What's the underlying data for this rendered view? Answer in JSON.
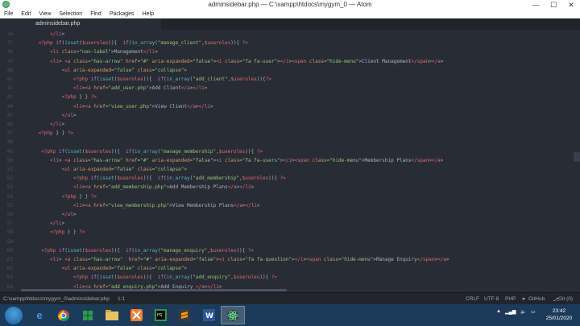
{
  "window": {
    "title": "adminsidebar.php — C:\\xampp\\htdocs\\mygym_0 — Atom",
    "minimize": "—",
    "maximize": "☐",
    "close": "✕"
  },
  "menu": [
    "File",
    "Edit",
    "View",
    "Selection",
    "Find",
    "Packages",
    "Help"
  ],
  "tab": {
    "label": "adminsidebar.php"
  },
  "editor": {
    "lines": [
      {
        "n": "36",
        "code": "          </li>"
      },
      {
        "n": "37",
        "code": "      <?php if(isset($useroles)){  if(in_array(\"manage_client\",$useroles)){ ?>"
      },
      {
        "n": "38",
        "code": "          <li class=\"nav-label\">Management</li>"
      },
      {
        "n": "39",
        "code": "          <li> <a class=\"has-arrow\" href=\"#\" aria-expanded=\"false\"><i class=\"fa fa-user\"></i><span class=\"hide-menu\">Client Management</span></a>"
      },
      {
        "n": "40",
        "code": "              <ul aria-expanded=\"false\" class=\"collapse\">"
      },
      {
        "n": "41",
        "code": "                  <?php if(isset($useroles)){  if(in_array(\"add_client\",$useroles)){?>"
      },
      {
        "n": "42",
        "code": "                  <li><a href=\"add_user.php\">Add Client</a></li>"
      },
      {
        "n": "43",
        "code": "              <?php } } ?>"
      },
      {
        "n": "44",
        "code": "                  <li><a href=\"view_user.php\">View Client</a></li>"
      },
      {
        "n": "45",
        "code": "              </ul>"
      },
      {
        "n": "46",
        "code": "          </li>"
      },
      {
        "n": "47",
        "code": "      <?php } } ?>"
      },
      {
        "n": "48",
        "code": ""
      },
      {
        "n": "49",
        "code": "       <?php if(isset($useroles)){  if(in_array(\"manage_membership\",$useroles)){ ?>"
      },
      {
        "n": "50",
        "code": "          <li> <a class=\"has-arrow\" href=\"#\" aria-expanded=\"false\"><i class=\"fa fa-users\"></i><span class=\"hide-menu\">Membership Plans</span></a>"
      },
      {
        "n": "51",
        "code": "              <ul aria-expanded=\"false\" class=\"collapse\">"
      },
      {
        "n": "52",
        "code": "                  <?php if(isset($useroles)){  if(in_array(\"add_membership\",$useroles)){ ?>"
      },
      {
        "n": "53",
        "code": "                  <li><a href=\"add_membership.php\">Add Membership Plans</a></li>"
      },
      {
        "n": "54",
        "code": "              <?php } } ?>"
      },
      {
        "n": "55",
        "code": "                  <li><a href=\"view_membership.php\">View Membership Plans</a></li>"
      },
      {
        "n": "56",
        "code": "              </ul>"
      },
      {
        "n": "57",
        "code": "          </li>"
      },
      {
        "n": "58",
        "code": "          <?php } } ?>"
      },
      {
        "n": "59",
        "code": ""
      },
      {
        "n": "60",
        "code": "       <?php if(isset($useroles)){  if(in_array(\"manage_enquiry\",$useroles)){ ?>"
      },
      {
        "n": "61",
        "code": "          <li> <a class=\"has-arrow\"  href=\"#\" aria-expanded=\"false\"><i class=\"fa fa-question\"></i><span class=\"hide-menu\">Manage Enquiry</span></a>"
      },
      {
        "n": "62",
        "code": "              <ul aria-expanded=\"false\" class=\"collapse\">"
      },
      {
        "n": "63",
        "code": "                  <?php if(isset($useroles)){  if(in_array(\"add_enquiry\",$useroles)){ ?>"
      },
      {
        "n": "64",
        "code": "                  <li><a href=\"add_enquiry.php\">Add Enquiry </a></li>"
      }
    ]
  },
  "status": {
    "path": "C:\\xampp\\htdocs\\mygym_0\\adminsidebar.php",
    "cursor": "1:1",
    "line_ending": "CRLF",
    "encoding": "UTF-8",
    "grammar": "PHP",
    "github": "GitHub",
    "git": "Git (0)"
  },
  "taskbar": {
    "icons": [
      "windows-start-icon",
      "ie-icon",
      "chrome-icon",
      "store-icon",
      "explorer-icon",
      "xampp-icon",
      "phpstorm-icon",
      "sublime-icon",
      "word-icon",
      "atom-icon"
    ],
    "time": "23:42",
    "date": "25/01/2020"
  }
}
